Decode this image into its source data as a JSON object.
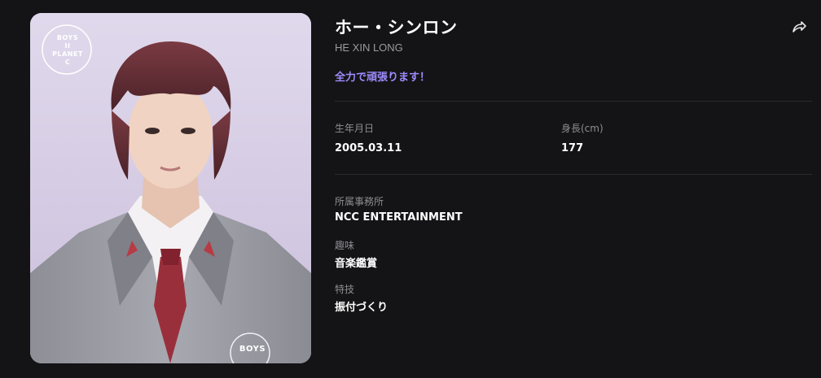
{
  "profile": {
    "name_jp": "ホー・シンロン",
    "name_en": "HE XIN LONG",
    "catchphrase": "全力で頑張ります！",
    "photo_logo_top": [
      "BOYS",
      "II",
      "PLANET",
      "C"
    ],
    "photo_logo_bottom": "BOYS"
  },
  "stats": {
    "birthday_label": "生年月日",
    "birthday_value": "2005.03.11",
    "height_label": "身長(cm)",
    "height_value": "177"
  },
  "details": {
    "agency_label": "所属事務所",
    "agency_value": "NCC ENTERTAINMENT",
    "hobby_label": "趣味",
    "hobby_value": "音楽鑑賞",
    "skill_label": "特技",
    "skill_value": "振付づくり"
  },
  "icons": {
    "share": "share-icon"
  },
  "colors": {
    "background": "#141416",
    "accent": "#9f8cff",
    "label": "#8d8d93",
    "divider": "#2b2b2f"
  }
}
